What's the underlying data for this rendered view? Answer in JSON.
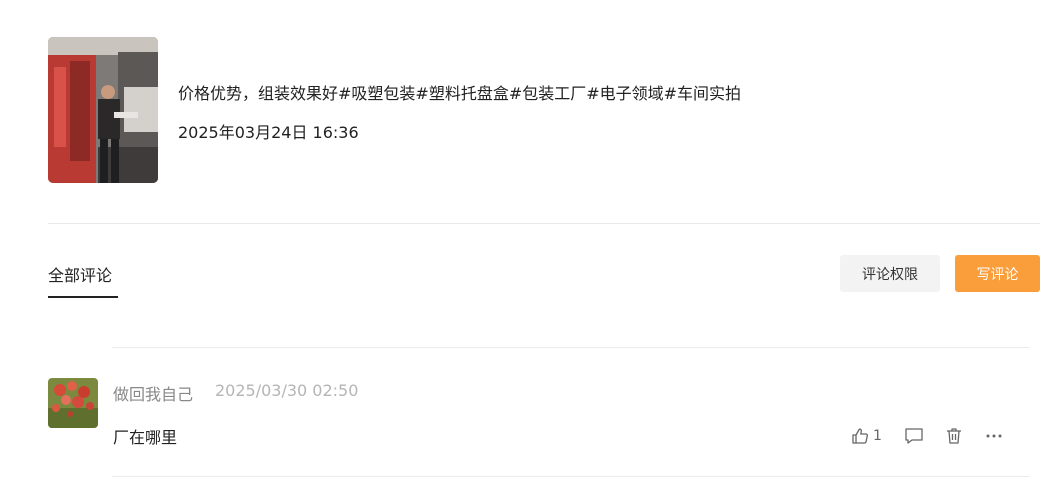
{
  "post": {
    "title": "价格优势，组装效果好#吸塑包装#塑料托盘盒#包装工厂#电子领域#车间实拍",
    "time": "2025年03月24日 16:36"
  },
  "comments_header": {
    "tab_label": "全部评论",
    "permission_button": "评论权限",
    "write_button": "写评论"
  },
  "comments": [
    {
      "author": "做回我自己",
      "time": "2025/03/30 02:50",
      "text": "厂在哪里",
      "likes": "1"
    }
  ],
  "icons": {
    "like": "thumbs-up-icon",
    "reply": "comment-bubble-icon",
    "delete": "trash-icon",
    "more": "more-horizontal-icon"
  },
  "colors": {
    "accent": "#fa9d3b",
    "secondary_button_bg": "#f3f3f3",
    "muted_text": "#888888",
    "timestamp_text": "#b5b5b5"
  }
}
